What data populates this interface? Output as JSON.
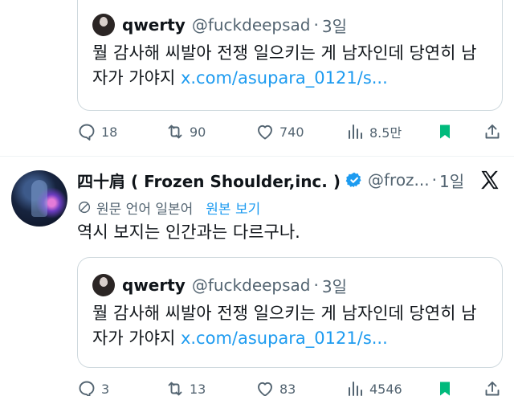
{
  "quote_top": {
    "name": "qwerty",
    "handle": "@fuckdeepsad",
    "sep": "·",
    "time": "3일",
    "text": "뭘 감사해 씨발아 전쟁 일으키는 게 남자인데 당연히 남자가 가야지 ",
    "link": "x.com/asupara_0121/s..."
  },
  "actions_top": {
    "replies": "18",
    "reposts": "90",
    "likes": "740",
    "views": "8.5만"
  },
  "post": {
    "name": "四十肩 ( Frozen Shoulder,inc. )",
    "handle": "@froz...",
    "sep": "·",
    "time": "1일",
    "translate_label": "원문 언어 일본어",
    "translate_button": "원본 보기",
    "text": "역시 보지는 인간과는 다르구나."
  },
  "quote_bottom": {
    "name": "qwerty",
    "handle": "@fuckdeepsad",
    "sep": "·",
    "time": "3일",
    "text": "뭘 감사해 씨발아 전쟁 일으키는 게 남자인데 당연히 남자가 가야지 ",
    "link": "x.com/asupara_0121/s..."
  },
  "actions_bottom": {
    "replies": "3",
    "reposts": "13",
    "likes": "83",
    "views": "4546"
  },
  "colors": {
    "accent": "#1d9bf0",
    "bookmark": "#00ba7c",
    "muted": "#536471",
    "text": "#0f1419"
  },
  "icons": [
    "reply-icon",
    "repost-icon",
    "like-icon",
    "views-icon",
    "bookmark-icon",
    "share-icon",
    "verified-badge-icon",
    "translate-icon",
    "x-logo-icon"
  ]
}
